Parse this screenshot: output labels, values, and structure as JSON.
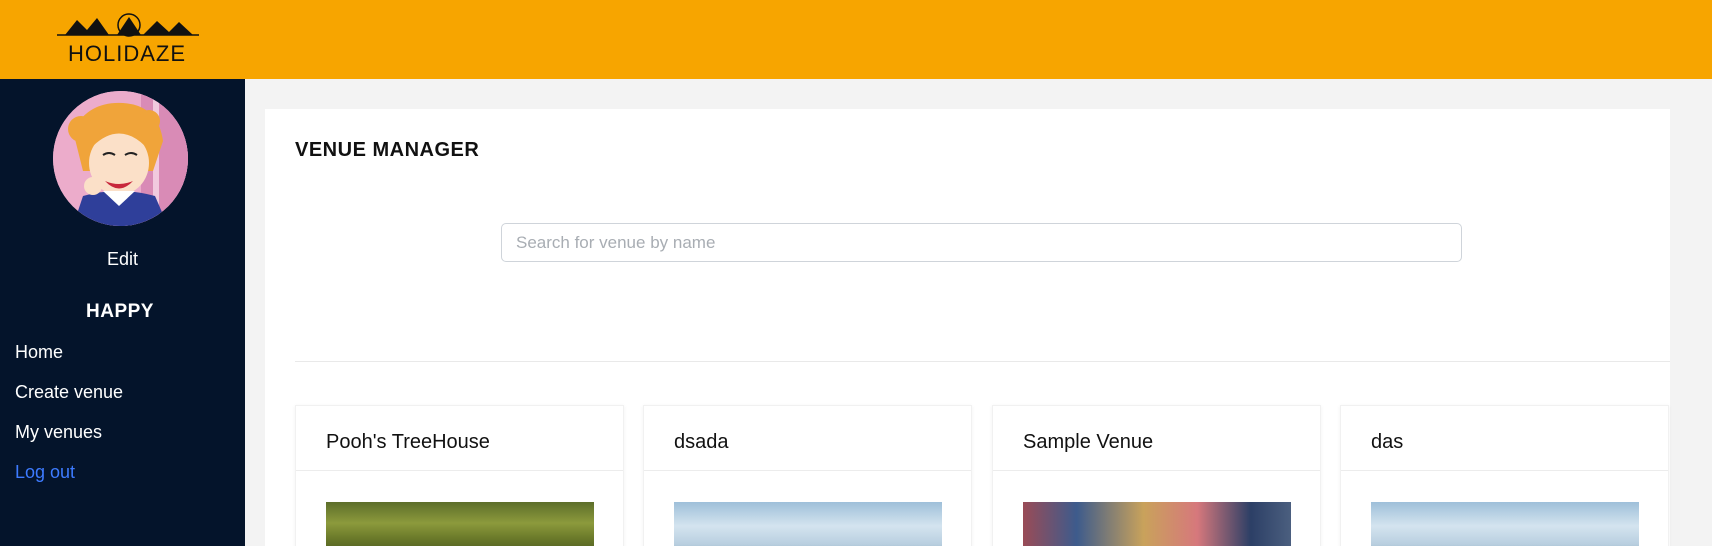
{
  "app": {
    "brand": "HOLIDAZE",
    "colors": {
      "topbar": "#f7a500",
      "sidebar": "#04142b",
      "logout": "#3d7bff"
    }
  },
  "sidebar": {
    "avatar_icon": "user-avatar",
    "edit_label": "Edit",
    "username": "HAPPY",
    "nav": [
      {
        "label": "Home"
      },
      {
        "label": "Create venue"
      },
      {
        "label": "My venues"
      },
      {
        "label": "Log out"
      }
    ]
  },
  "main": {
    "title": "VENUE MANAGER",
    "search": {
      "placeholder": "Search for venue by name",
      "value": ""
    },
    "venues": [
      {
        "name": "Pooh's TreeHouse"
      },
      {
        "name": "dsada"
      },
      {
        "name": "Sample Venue"
      },
      {
        "name": "das"
      }
    ]
  }
}
